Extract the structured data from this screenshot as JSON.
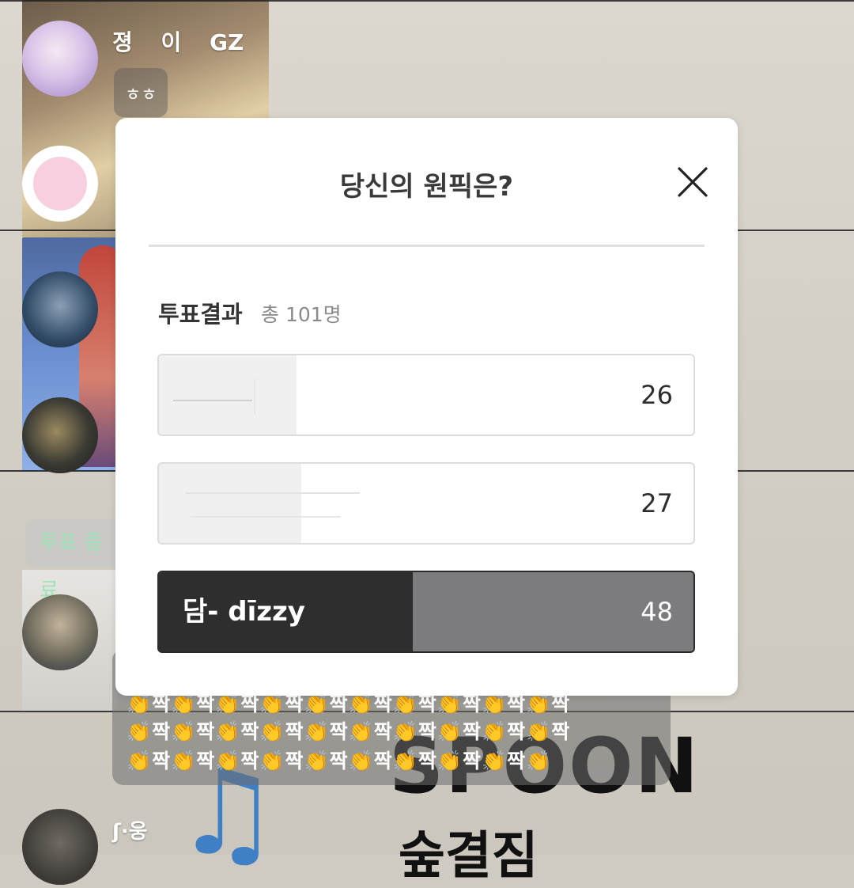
{
  "background_chat": {
    "users": [
      {
        "name": "졍 이 GZ"
      },
      {
        "name": ""
      },
      {
        "name": ""
      },
      {
        "name": ""
      },
      {
        "name": ""
      },
      {
        "name": "ʃ·웅"
      }
    ],
    "message_hehe": "ㅎㅎ",
    "vote_end_label": "투표 종료",
    "clap_lines": [
      "👏짝👏짝👏짝👏짝👏짝👏짝👏짝👏짝👏짝👏짝",
      "👏짝👏짝👏짝👏짝👏짝👏짝👏짝👏짝👏짝👏짝",
      "👏짝👏짝👏짝👏짝👏짝👏짝👏짝👏짝👏짝👏"
    ],
    "wall_text_1": "SPOON",
    "wall_text_2": "숲결짐"
  },
  "poll_modal": {
    "title": "당신의 원픽은?",
    "close_icon": "close-icon",
    "results_label": "투표결과",
    "total_label": "총 101명",
    "options": [
      {
        "label": "",
        "count": "26",
        "share": 0.257,
        "winner": false
      },
      {
        "label": "",
        "count": "27",
        "share": 0.267,
        "winner": false
      },
      {
        "label": "담- dīzzy",
        "count": "48",
        "share": 0.475,
        "winner": true
      }
    ],
    "colors": {
      "winner_fill": "#2e2e2e",
      "winner_rest": "#7c7b7e",
      "option_fill": "#f0f0f0",
      "border": "#dcdcdc"
    }
  }
}
